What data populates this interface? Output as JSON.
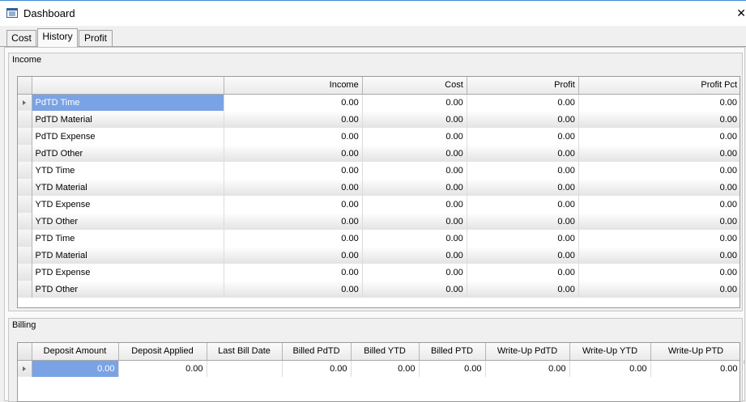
{
  "window": {
    "title": "Dashboard",
    "close_glyph": "✕"
  },
  "tabs": [
    {
      "label": "Cost",
      "active": false
    },
    {
      "label": "History",
      "active": true
    },
    {
      "label": "Profit",
      "active": false
    }
  ],
  "income": {
    "group_label": "Income",
    "columns": [
      "",
      "Income",
      "Cost",
      "Profit",
      "Profit Pct"
    ],
    "rows": [
      {
        "label": "PdTD Time",
        "values": [
          "0.00",
          "0.00",
          "0.00",
          "0.00"
        ]
      },
      {
        "label": "PdTD Material",
        "values": [
          "0.00",
          "0.00",
          "0.00",
          "0.00"
        ]
      },
      {
        "label": "PdTD Expense",
        "values": [
          "0.00",
          "0.00",
          "0.00",
          "0.00"
        ]
      },
      {
        "label": "PdTD Other",
        "values": [
          "0.00",
          "0.00",
          "0.00",
          "0.00"
        ]
      },
      {
        "label": "YTD Time",
        "values": [
          "0.00",
          "0.00",
          "0.00",
          "0.00"
        ]
      },
      {
        "label": "YTD Material",
        "values": [
          "0.00",
          "0.00",
          "0.00",
          "0.00"
        ]
      },
      {
        "label": "YTD Expense",
        "values": [
          "0.00",
          "0.00",
          "0.00",
          "0.00"
        ]
      },
      {
        "label": "YTD Other",
        "values": [
          "0.00",
          "0.00",
          "0.00",
          "0.00"
        ]
      },
      {
        "label": "PTD Time",
        "values": [
          "0.00",
          "0.00",
          "0.00",
          "0.00"
        ]
      },
      {
        "label": "PTD Material",
        "values": [
          "0.00",
          "0.00",
          "0.00",
          "0.00"
        ]
      },
      {
        "label": "PTD Expense",
        "values": [
          "0.00",
          "0.00",
          "0.00",
          "0.00"
        ]
      },
      {
        "label": "PTD Other",
        "values": [
          "0.00",
          "0.00",
          "0.00",
          "0.00"
        ]
      }
    ]
  },
  "billing": {
    "group_label": "Billing",
    "columns": [
      "Deposit Amount",
      "Deposit Applied",
      "Last Bill Date",
      "Billed PdTD",
      "Billed YTD",
      "Billed PTD",
      "Write-Up PdTD",
      "Write-Up YTD",
      "Write-Up PTD"
    ],
    "row": [
      "0.00",
      "0.00",
      "",
      "0.00",
      "0.00",
      "0.00",
      "0.00",
      "0.00",
      "0.00"
    ]
  },
  "colors": {
    "selection": "#7aa3e5",
    "title_border": "#3c8bd6"
  },
  "icons": {
    "window": "dashboard-form-icon",
    "close": "close-icon",
    "row_indicator": "row-pointer-icon"
  }
}
